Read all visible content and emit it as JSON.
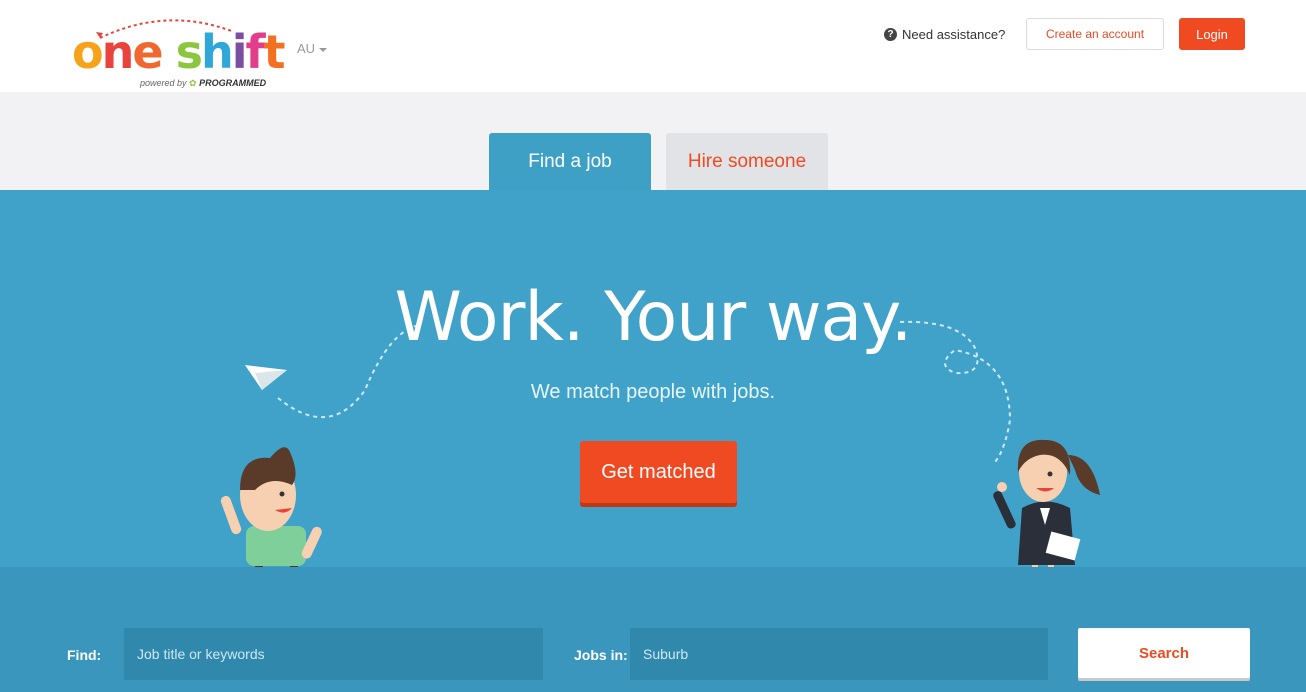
{
  "header": {
    "logo": {
      "word": "one shift",
      "tagline_prefix": "powered by",
      "tagline_brand": "PROGRAMMED"
    },
    "region": "AU",
    "help_text": "Need assistance?",
    "create_account_label": "Create an account",
    "login_label": "Login"
  },
  "tabs": [
    {
      "label": "Find a job",
      "active": true
    },
    {
      "label": "Hire someone",
      "active": false
    }
  ],
  "hero": {
    "title": "Work. Your way.",
    "subtitle": "We match people with jobs.",
    "cta_label": "Get matched"
  },
  "search": {
    "find_label": "Find:",
    "find_placeholder": "Job title or keywords",
    "location_label": "Jobs in:",
    "location_placeholder": "Suburb",
    "button_label": "Search"
  },
  "colors": {
    "accent": "#f04a23",
    "hero_bg": "#40a2c8",
    "search_bg": "#3a96bd"
  },
  "icons": {
    "help": "question-circle-icon",
    "region_caret": "caret-down-icon"
  }
}
